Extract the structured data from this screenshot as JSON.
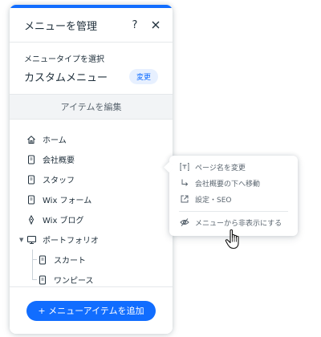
{
  "panel": {
    "title": "メニューを管理",
    "help_icon": "question-mark-icon",
    "close_icon": "close-icon",
    "type_label": "メニュータイプを選択",
    "type_value": "カスタムメニュー",
    "change_label": "変更",
    "edit_bar_label": "アイテムを編集",
    "add_button_label": "+ メニューアイテムを追加",
    "accent_color": "#116dff"
  },
  "menu_items": [
    {
      "label": "ホーム",
      "icon": "home-icon"
    },
    {
      "label": "会社概要",
      "icon": "page-icon"
    },
    {
      "label": "スタッフ",
      "icon": "page-icon"
    },
    {
      "label": "Wix フォーム",
      "icon": "page-icon"
    },
    {
      "label": "Wix ブログ",
      "icon": "blog-icon"
    },
    {
      "label": "ポートフォリオ",
      "icon": "portfolio-icon"
    },
    {
      "label": "スカート",
      "icon": "page-icon"
    },
    {
      "label": "ワンピース",
      "icon": "page-icon"
    }
  ],
  "context_menu": {
    "rename": "ページ名を変更",
    "move_under": "会社概要の下へ移動",
    "settings_seo": "設定・SEO",
    "hide": "メニューから非表示にする"
  }
}
